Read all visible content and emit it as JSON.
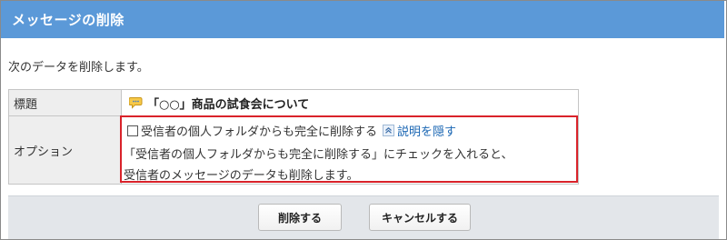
{
  "dialog": {
    "title": "メッセージの削除",
    "intro": "次のデータを削除します。"
  },
  "form": {
    "subject_label": "標題",
    "subject_value": "「○○」商品の試食会について",
    "option_label": "オプション",
    "option_checkbox_label": "受信者の個人フォルダからも完全に削除する",
    "option_checked": false,
    "toggle_link": "説明を隠す",
    "description_line1": "「受信者の個人フォルダからも完全に削除する」にチェックを入れると、",
    "description_line2": "受信者のメッセージのデータも削除します。"
  },
  "buttons": {
    "delete_label": "削除する",
    "cancel_label": "キャンセルする"
  },
  "colors": {
    "title_bar": "#5b99d8",
    "highlight_border": "#d9222a",
    "link": "#1a66b3"
  },
  "icons": {
    "subject": "message-balloon-icon",
    "toggle": "collapse-up-icon"
  }
}
